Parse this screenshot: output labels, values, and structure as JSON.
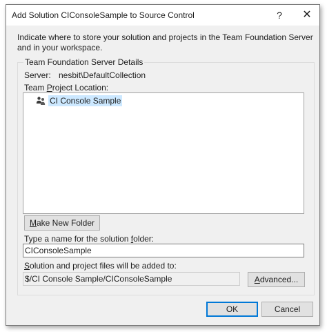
{
  "window": {
    "title": "Add Solution CIConsoleSample to Source Control",
    "help_label": "?",
    "close_label": "✕"
  },
  "instruction": "Indicate where to store your solution and projects in the Team Foundation Server and in your workspace.",
  "group": {
    "label": "Team Foundation Server Details",
    "server_label": "Server:",
    "server_value": "nesbit\\DefaultCollection",
    "location_label": "Team Project Location:"
  },
  "tree": {
    "items": [
      {
        "label": "CI Console Sample",
        "icon": "team-project-icon",
        "selected": true
      }
    ]
  },
  "buttons": {
    "new_folder": "Make New Folder",
    "advanced": "Advanced...",
    "ok": "OK",
    "cancel": "Cancel"
  },
  "folder_name": {
    "label": "Type a name for the solution folder:",
    "value": "CIConsoleSample"
  },
  "files": {
    "label": "Solution and project files will be added to:",
    "path": "$/CI Console Sample/CIConsoleSample"
  },
  "colors": {
    "dialog_bg": "#f0f0f0",
    "selection_bg": "#cce8ff",
    "default_button_border": "#0078d7"
  }
}
